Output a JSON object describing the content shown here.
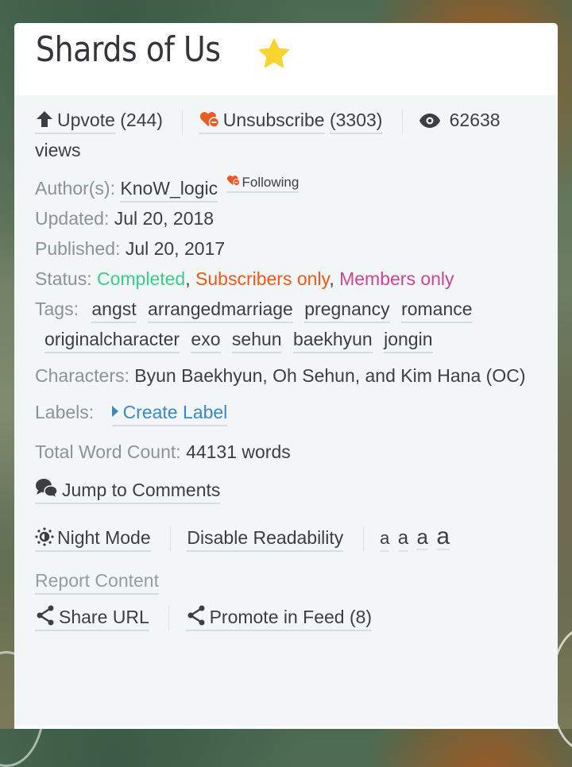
{
  "story": {
    "title": "Shards of Us",
    "favorite_icon": "star-icon",
    "favorite_color": "#f8d42f"
  },
  "stats": {
    "upvote_label": "Upvote",
    "upvote_count": "(244)",
    "unsubscribe_label": "Unsubscribe",
    "subscriber_count": "(3303)",
    "views_count": "62638",
    "views_suffix": "views"
  },
  "meta": {
    "author_label": "Author(s):",
    "author_name": "KnoW_logic",
    "following_label": "Following",
    "updated_label": "Updated:",
    "updated_value": "Jul 20, 2018",
    "published_label": "Published:",
    "published_value": "Jul 20, 2017",
    "status_label": "Status:",
    "status_completed": "Completed",
    "status_subscribers": "Subscribers only",
    "status_members": "Members only",
    "status_sep": ",",
    "tags_label": "Tags:",
    "tags": [
      "angst",
      "arrangedmarriage",
      "pregnancy",
      "romance",
      "originalcharacter",
      "exo",
      "sehun",
      "baekhyun",
      "jongin"
    ],
    "characters_label": "Characters:",
    "characters_value": "Byun Baekhyun, Oh Sehun, and Kim Hana (OC)",
    "labels_label": "Labels:",
    "create_label": "Create Label",
    "wordcount_label": "Total Word Count:",
    "wordcount_value": "44131 words"
  },
  "actions": {
    "jump_comments": "Jump to Comments",
    "night_mode": "Night Mode",
    "disable_readability": "Disable Readability",
    "font_sizes": [
      "a",
      "a",
      "a",
      "a"
    ],
    "report_content": "Report Content",
    "share_url": "Share URL",
    "promote_feed": "Promote in Feed (8)"
  },
  "colors": {
    "accent_link": "#3b88c3",
    "heart": "#ec5a24",
    "completed": "#3dcb8b",
    "subscribers": "#e85a1c",
    "members": "#c8478f"
  }
}
